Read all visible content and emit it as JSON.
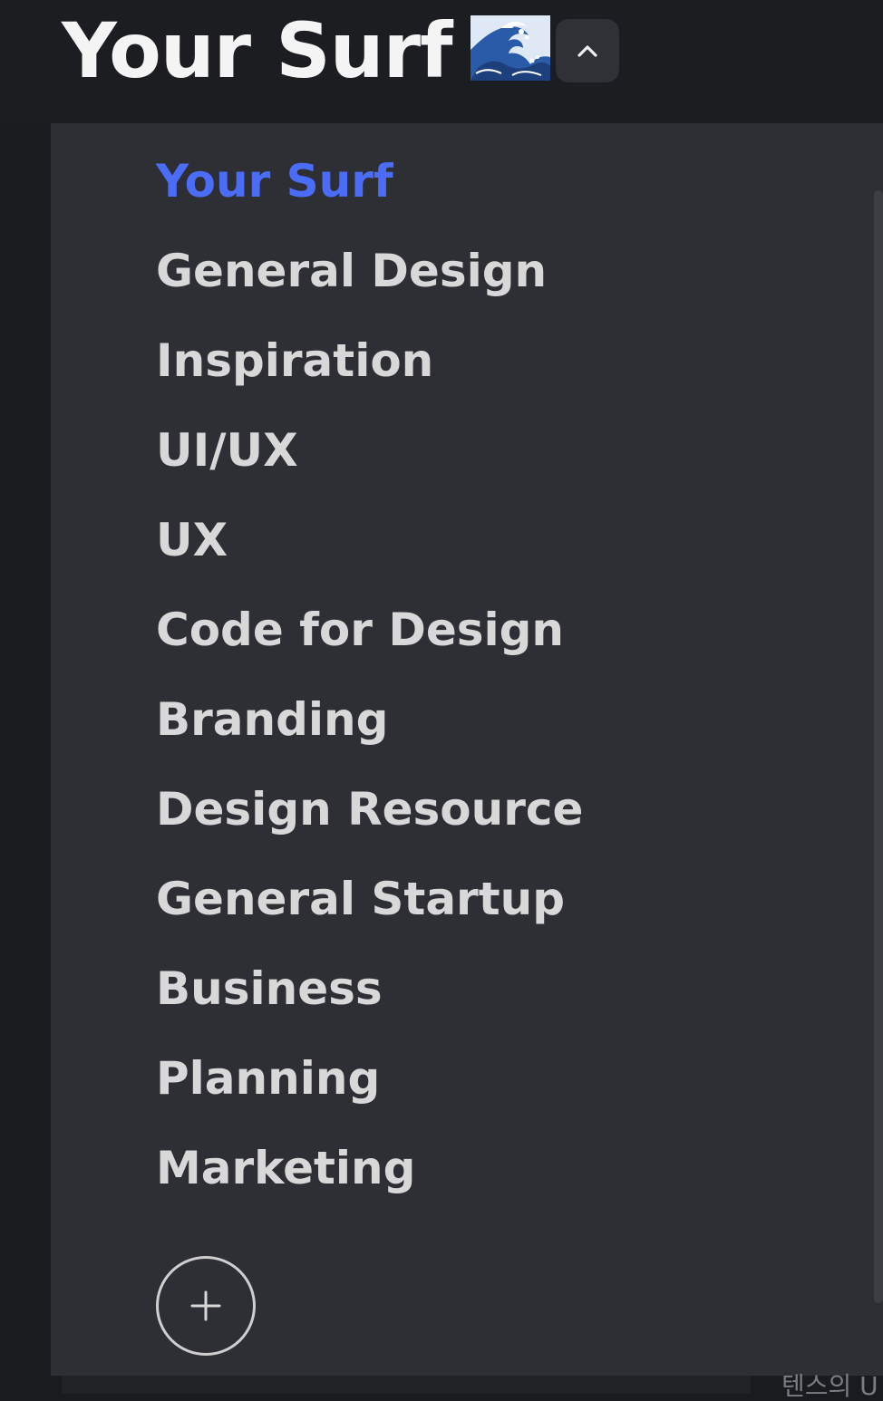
{
  "header": {
    "title": "Your Surf",
    "emoji": "wave-emoji",
    "collapse_icon": "chevron-up-icon"
  },
  "menu": {
    "items": [
      {
        "label": "Your Surf",
        "active": true
      },
      {
        "label": "General Design",
        "active": false
      },
      {
        "label": "Inspiration",
        "active": false
      },
      {
        "label": "UI/UX",
        "active": false
      },
      {
        "label": "UX",
        "active": false
      },
      {
        "label": "Code for Design",
        "active": false
      },
      {
        "label": "Branding",
        "active": false
      },
      {
        "label": "Design Resource",
        "active": false
      },
      {
        "label": "General Startup",
        "active": false
      },
      {
        "label": "Business",
        "active": false
      },
      {
        "label": "Planning",
        "active": false
      },
      {
        "label": "Marketing",
        "active": false
      }
    ],
    "add_icon": "plus-icon"
  },
  "background": {
    "partial_text": "텐스의 U"
  },
  "colors": {
    "accent": "#4a6cf7",
    "menu_text": "#d8d8d8",
    "panel_bg": "#2d2f34",
    "page_bg": "#1a1b1e"
  }
}
